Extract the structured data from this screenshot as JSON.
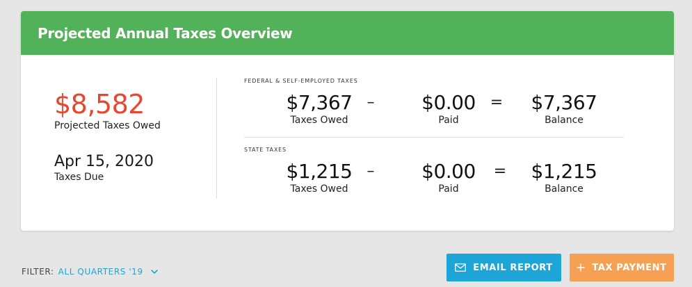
{
  "header": {
    "title": "Projected Annual Taxes Overview"
  },
  "summary": {
    "total_amount": "$8,582",
    "total_label": "Projected Taxes Owed",
    "due_date": "Apr 15, 2020",
    "due_label": "Taxes Due"
  },
  "federal": {
    "section_label": "FEDERAL & SELF-EMPLOYED TAXES",
    "owed": "$7,367",
    "owed_label": "Taxes Owed",
    "minus": "–",
    "paid": "$0.00",
    "paid_label": "Paid",
    "equals": "=",
    "balance": "$7,367",
    "balance_label": "Balance"
  },
  "state": {
    "section_label": "STATE TAXES",
    "owed": "$1,215",
    "owed_label": "Taxes Owed",
    "minus": "–",
    "paid": "$0.00",
    "paid_label": "Paid",
    "equals": "=",
    "balance": "$1,215",
    "balance_label": "Balance"
  },
  "filter": {
    "label": "FILTER:",
    "value": "ALL QUARTERS '19",
    "icon": "chevron-down-icon"
  },
  "actions": {
    "email_label": "EMAIL REPORT",
    "email_icon": "mail-icon",
    "pay_label": "TAX PAYMENT",
    "pay_icon": "plus-icon"
  },
  "colors": {
    "header_green": "#52b25a",
    "total_red": "#e8472e",
    "link_blue": "#1ea5d8",
    "pay_orange": "#f5a053"
  }
}
